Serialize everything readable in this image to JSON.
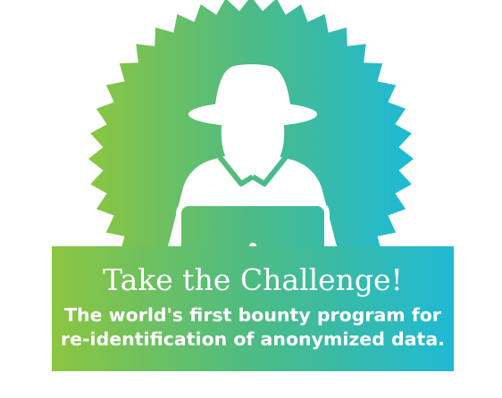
{
  "banner": {
    "headline": "Take the Challenge!",
    "subtitle_line1": "The world's first bounty program for",
    "subtitle_line2": "re-identification of anonymized data."
  },
  "illustration": {
    "icon": "hacker-with-hat-and-laptop-icon",
    "seal": "serrated-seal-badge"
  },
  "colors": {
    "gradient_start": "#8cc63f",
    "gradient_mid": "#4dbb84",
    "gradient_end": "#1fbad6",
    "figure": "#ffffff",
    "background": "#ffffff"
  }
}
